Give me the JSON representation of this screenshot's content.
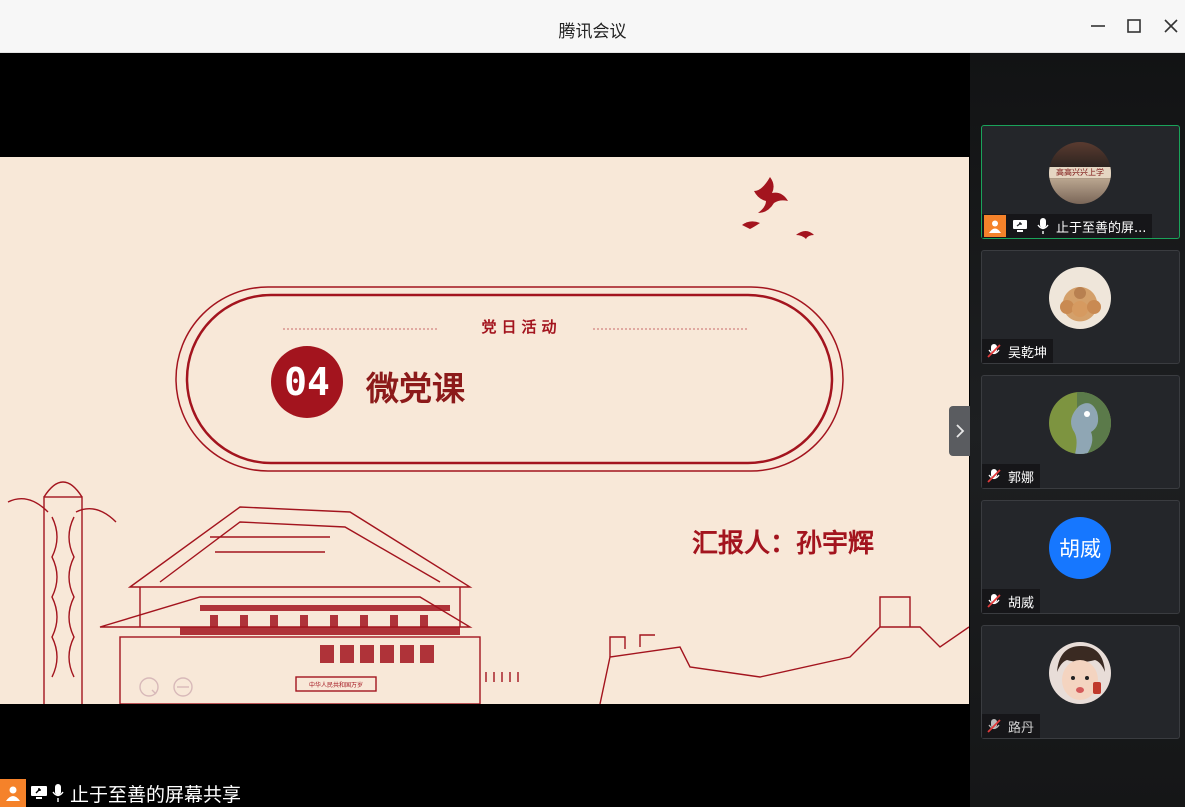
{
  "window": {
    "title": "腾讯会议"
  },
  "slide": {
    "section_label": "党日活动",
    "number": "04",
    "heading": "微党课",
    "presenter": "汇报人：孙宇辉",
    "monument_plaque": "中华人民共和国万岁"
  },
  "participants": [
    {
      "name": "止于至善的屏...",
      "avatar_text": "高高兴兴上学",
      "mic": "on",
      "sharing": true,
      "host": true,
      "active": true
    },
    {
      "name": "吴乾坤",
      "mic": "muted"
    },
    {
      "name": "郭娜",
      "mic": "muted"
    },
    {
      "name": "胡威",
      "avatar_text": "胡威",
      "mic": "muted",
      "avatar_color": "#1677ff"
    },
    {
      "name": "路丹",
      "mic": "muted"
    }
  ],
  "share_status": "止于至善的屏幕共享",
  "colors": {
    "accent_red": "#a3141e",
    "slide_bg": "#f8e8d8",
    "active_border": "#1aa35a",
    "host_badge": "#f5822a"
  }
}
